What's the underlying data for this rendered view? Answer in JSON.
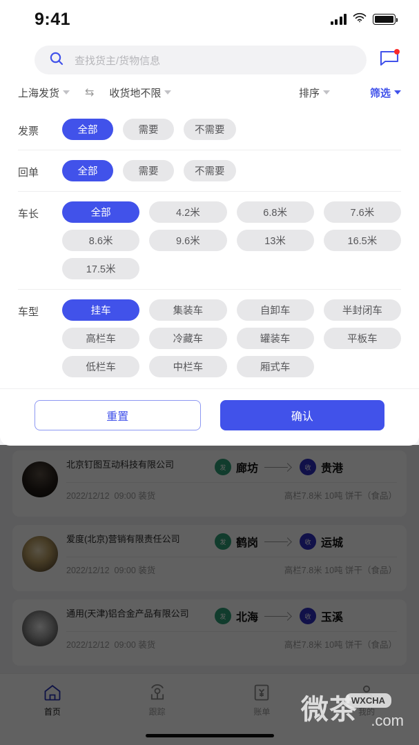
{
  "statusbar": {
    "time": "9:41",
    "signal_icon": "signal-bars-icon",
    "wifi_icon": "wifi-icon",
    "battery_icon": "battery-full-icon"
  },
  "search": {
    "icon": "search-icon",
    "placeholder": "查找货主/货物信息",
    "value": "",
    "message_icon": "chat-bubble-icon",
    "has_unread_badge": true
  },
  "dropdown_row": {
    "origin": "上海发货",
    "swap_icon": "swap-arrows-icon",
    "destination": "收货地不限",
    "sort": "排序",
    "filter": "筛选",
    "filter_active": true,
    "active_color": "#4152ea"
  },
  "filters": {
    "groups": [
      {
        "label": "发票",
        "name": "invoice",
        "layout": "flow",
        "options": [
          "全部",
          "需要",
          "不需要"
        ],
        "selected": "全部"
      },
      {
        "label": "回单",
        "name": "receipt",
        "layout": "flow",
        "options": [
          "全部",
          "需要",
          "不需要"
        ],
        "selected": "全部"
      },
      {
        "label": "车长",
        "name": "vehicle-length",
        "layout": "grid4",
        "options": [
          "全部",
          "4.2米",
          "6.8米",
          "7.6米",
          "8.6米",
          "9.6米",
          "13米",
          "16.5米",
          "17.5米"
        ],
        "selected": "全部"
      },
      {
        "label": "车型",
        "name": "vehicle-type",
        "layout": "grid4",
        "options": [
          "挂车",
          "集装车",
          "自卸车",
          "半封闭车",
          "高栏车",
          "冷藏车",
          "罐装车",
          "平板车",
          "低栏车",
          "中栏车",
          "厢式车"
        ],
        "selected": "挂车"
      }
    ],
    "chip_selected_color": "#4152ea",
    "chip_default_color": "#e7e7e9"
  },
  "actions": {
    "reset": "重置",
    "confirm": "确认"
  },
  "feed": {
    "cards": [
      {
        "company": "北京钉图互动科技有限公司",
        "origin_badge": "发",
        "origin_city": "廊坊",
        "dest_badge": "收",
        "dest_city": "贵港",
        "date": "2022/12/12",
        "time": "09:00",
        "action": "装货",
        "cargo": "高栏7.8米 10吨 饼干（食品）"
      },
      {
        "company": "爱度(北京)营销有限责任公司",
        "origin_badge": "发",
        "origin_city": "鹤岗",
        "dest_badge": "收",
        "dest_city": "运城",
        "date": "2022/12/12",
        "time": "09:00",
        "action": "装货",
        "cargo": "高栏7.8米 10吨 饼干（食品）"
      },
      {
        "company": "通用(天津)铝合金产品有限公司",
        "origin_badge": "发",
        "origin_city": "北海",
        "dest_badge": "收",
        "dest_city": "玉溪",
        "date": "2022/12/12",
        "time": "09:00",
        "action": "装货",
        "cargo": "高栏7.8米 10吨 饼干（食品）"
      }
    ]
  },
  "tabbar": {
    "tabs": [
      {
        "label": "首页",
        "icon": "home-icon",
        "active": true
      },
      {
        "label": "跟踪",
        "icon": "location-pin-icon",
        "active": false
      },
      {
        "label": "账单",
        "icon": "bill-yuan-icon",
        "active": false
      },
      {
        "label": "我的",
        "icon": "person-icon",
        "active": false
      }
    ]
  },
  "watermark": {
    "text_cn": "微茶",
    "badge": "WXCHA",
    "domain": ".com"
  }
}
